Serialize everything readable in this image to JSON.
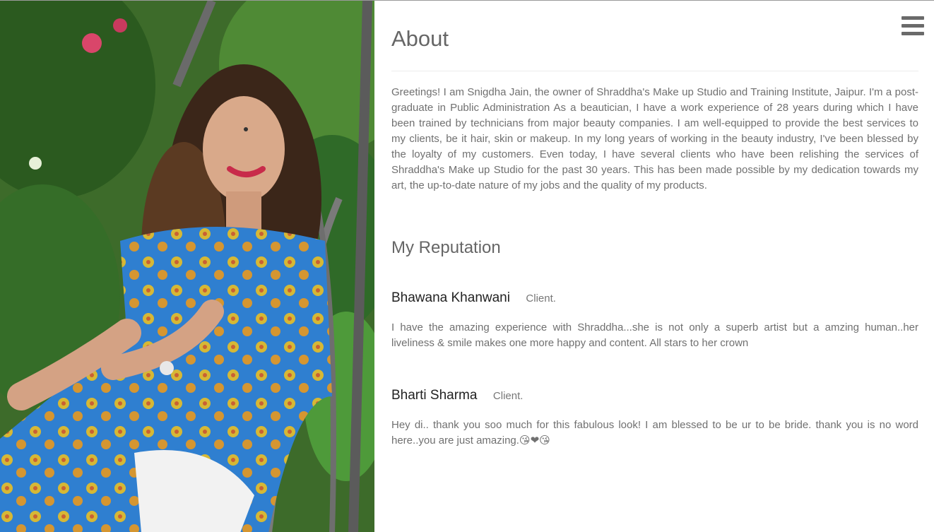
{
  "menu": {
    "icon": "hamburger-menu-icon"
  },
  "about": {
    "title": "About",
    "text": "Greetings! I am Snigdha Jain, the owner of Shraddha's Make up Studio and Training Institute, Jaipur. I'm a post-graduate in Public Administration As a beautician, I have a work experience of 28 years during which I have been trained by technicians from major beauty companies. I am well-equipped to provide the best services to my clients, be it hair, skin or makeup. In my long years of working in the beauty industry, I've been blessed by the loyalty of my customers. Even today, I have several clients who have been relishing the services of Shraddha's Make up Studio for the past 30 years. This has been made possible by my dedication towards my art, the up-to-date nature of my jobs and the quality of my products."
  },
  "reputation": {
    "title": "My Reputation",
    "reviews": [
      {
        "name": "Bhawana Khanwani",
        "role": "Client.",
        "text": "I have the amazing experience with Shraddha...she is not only a superb artist but a amzing human..her liveliness & smile makes one more happy and content. All stars to her crown"
      },
      {
        "name": "Bharti Sharma",
        "role": "Client.",
        "text": "Hey di.. thank you soo much for this fabulous look! I am blessed to be ur to be bride. thank you is no word here..you are just amazing.😘❤😘"
      }
    ]
  }
}
